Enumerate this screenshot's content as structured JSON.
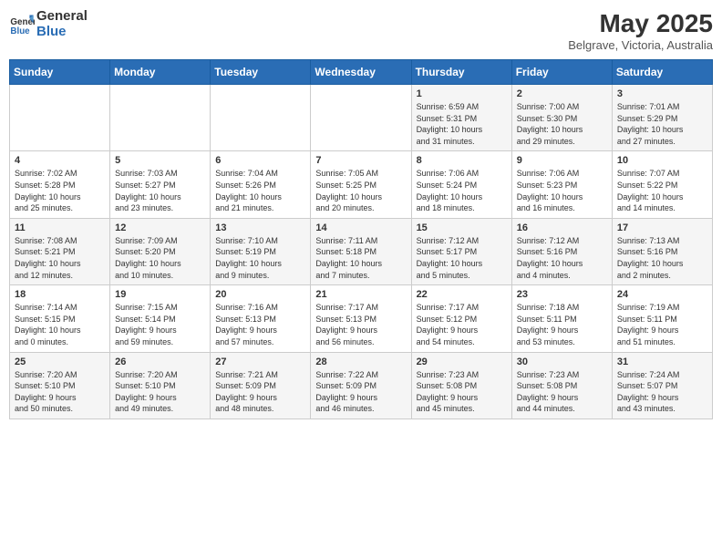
{
  "header": {
    "logo_line1": "General",
    "logo_line2": "Blue",
    "month_year": "May 2025",
    "location": "Belgrave, Victoria, Australia"
  },
  "weekdays": [
    "Sunday",
    "Monday",
    "Tuesday",
    "Wednesday",
    "Thursday",
    "Friday",
    "Saturday"
  ],
  "weeks": [
    [
      {
        "day": "",
        "info": ""
      },
      {
        "day": "",
        "info": ""
      },
      {
        "day": "",
        "info": ""
      },
      {
        "day": "",
        "info": ""
      },
      {
        "day": "1",
        "info": "Sunrise: 6:59 AM\nSunset: 5:31 PM\nDaylight: 10 hours\nand 31 minutes."
      },
      {
        "day": "2",
        "info": "Sunrise: 7:00 AM\nSunset: 5:30 PM\nDaylight: 10 hours\nand 29 minutes."
      },
      {
        "day": "3",
        "info": "Sunrise: 7:01 AM\nSunset: 5:29 PM\nDaylight: 10 hours\nand 27 minutes."
      }
    ],
    [
      {
        "day": "4",
        "info": "Sunrise: 7:02 AM\nSunset: 5:28 PM\nDaylight: 10 hours\nand 25 minutes."
      },
      {
        "day": "5",
        "info": "Sunrise: 7:03 AM\nSunset: 5:27 PM\nDaylight: 10 hours\nand 23 minutes."
      },
      {
        "day": "6",
        "info": "Sunrise: 7:04 AM\nSunset: 5:26 PM\nDaylight: 10 hours\nand 21 minutes."
      },
      {
        "day": "7",
        "info": "Sunrise: 7:05 AM\nSunset: 5:25 PM\nDaylight: 10 hours\nand 20 minutes."
      },
      {
        "day": "8",
        "info": "Sunrise: 7:06 AM\nSunset: 5:24 PM\nDaylight: 10 hours\nand 18 minutes."
      },
      {
        "day": "9",
        "info": "Sunrise: 7:06 AM\nSunset: 5:23 PM\nDaylight: 10 hours\nand 16 minutes."
      },
      {
        "day": "10",
        "info": "Sunrise: 7:07 AM\nSunset: 5:22 PM\nDaylight: 10 hours\nand 14 minutes."
      }
    ],
    [
      {
        "day": "11",
        "info": "Sunrise: 7:08 AM\nSunset: 5:21 PM\nDaylight: 10 hours\nand 12 minutes."
      },
      {
        "day": "12",
        "info": "Sunrise: 7:09 AM\nSunset: 5:20 PM\nDaylight: 10 hours\nand 10 minutes."
      },
      {
        "day": "13",
        "info": "Sunrise: 7:10 AM\nSunset: 5:19 PM\nDaylight: 10 hours\nand 9 minutes."
      },
      {
        "day": "14",
        "info": "Sunrise: 7:11 AM\nSunset: 5:18 PM\nDaylight: 10 hours\nand 7 minutes."
      },
      {
        "day": "15",
        "info": "Sunrise: 7:12 AM\nSunset: 5:17 PM\nDaylight: 10 hours\nand 5 minutes."
      },
      {
        "day": "16",
        "info": "Sunrise: 7:12 AM\nSunset: 5:16 PM\nDaylight: 10 hours\nand 4 minutes."
      },
      {
        "day": "17",
        "info": "Sunrise: 7:13 AM\nSunset: 5:16 PM\nDaylight: 10 hours\nand 2 minutes."
      }
    ],
    [
      {
        "day": "18",
        "info": "Sunrise: 7:14 AM\nSunset: 5:15 PM\nDaylight: 10 hours\nand 0 minutes."
      },
      {
        "day": "19",
        "info": "Sunrise: 7:15 AM\nSunset: 5:14 PM\nDaylight: 9 hours\nand 59 minutes."
      },
      {
        "day": "20",
        "info": "Sunrise: 7:16 AM\nSunset: 5:13 PM\nDaylight: 9 hours\nand 57 minutes."
      },
      {
        "day": "21",
        "info": "Sunrise: 7:17 AM\nSunset: 5:13 PM\nDaylight: 9 hours\nand 56 minutes."
      },
      {
        "day": "22",
        "info": "Sunrise: 7:17 AM\nSunset: 5:12 PM\nDaylight: 9 hours\nand 54 minutes."
      },
      {
        "day": "23",
        "info": "Sunrise: 7:18 AM\nSunset: 5:11 PM\nDaylight: 9 hours\nand 53 minutes."
      },
      {
        "day": "24",
        "info": "Sunrise: 7:19 AM\nSunset: 5:11 PM\nDaylight: 9 hours\nand 51 minutes."
      }
    ],
    [
      {
        "day": "25",
        "info": "Sunrise: 7:20 AM\nSunset: 5:10 PM\nDaylight: 9 hours\nand 50 minutes."
      },
      {
        "day": "26",
        "info": "Sunrise: 7:20 AM\nSunset: 5:10 PM\nDaylight: 9 hours\nand 49 minutes."
      },
      {
        "day": "27",
        "info": "Sunrise: 7:21 AM\nSunset: 5:09 PM\nDaylight: 9 hours\nand 48 minutes."
      },
      {
        "day": "28",
        "info": "Sunrise: 7:22 AM\nSunset: 5:09 PM\nDaylight: 9 hours\nand 46 minutes."
      },
      {
        "day": "29",
        "info": "Sunrise: 7:23 AM\nSunset: 5:08 PM\nDaylight: 9 hours\nand 45 minutes."
      },
      {
        "day": "30",
        "info": "Sunrise: 7:23 AM\nSunset: 5:08 PM\nDaylight: 9 hours\nand 44 minutes."
      },
      {
        "day": "31",
        "info": "Sunrise: 7:24 AM\nSunset: 5:07 PM\nDaylight: 9 hours\nand 43 minutes."
      }
    ]
  ]
}
